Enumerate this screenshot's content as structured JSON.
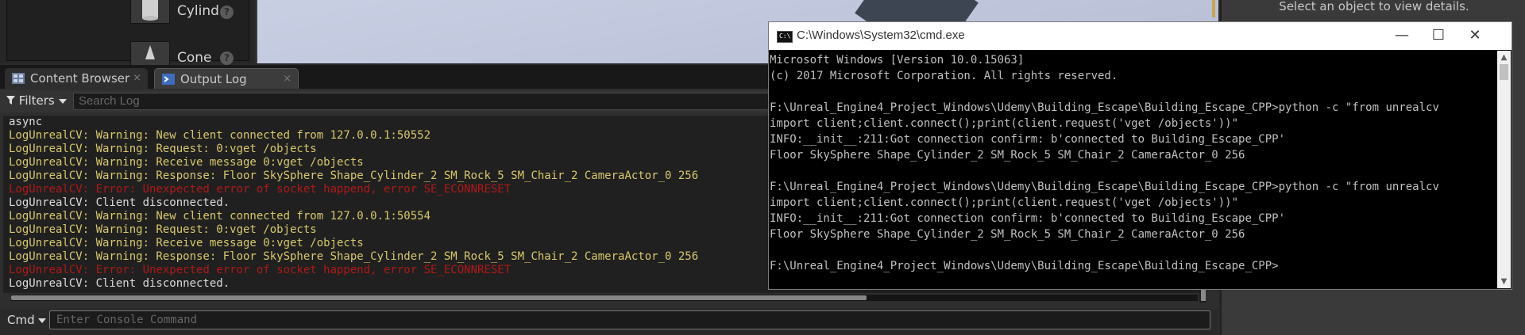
{
  "placement": {
    "items": [
      {
        "label": "Cylind"
      },
      {
        "label": "Cone"
      }
    ],
    "info_glyph": "?"
  },
  "details": {
    "hint": "Select an object to view details."
  },
  "tabs": [
    {
      "label": "Content Browser",
      "icon": "content-browser-icon",
      "close": "×",
      "active": false
    },
    {
      "label": "Output Log",
      "icon": "output-log-icon",
      "close": "×",
      "active": true
    }
  ],
  "output_log": {
    "filters_label": "Filters",
    "search_placeholder": "Search Log",
    "lines": [
      {
        "text": "async",
        "level": "info"
      },
      {
        "text": "LogUnrealCV: Warning: New client connected from 127.0.0.1:50552",
        "level": "warning"
      },
      {
        "text": "LogUnrealCV: Warning: Request: 0:vget /objects",
        "level": "warning"
      },
      {
        "text": "LogUnrealCV: Warning: Receive message 0:vget /objects",
        "level": "warning"
      },
      {
        "text": "LogUnrealCV: Warning: Response: Floor SkySphere Shape_Cylinder_2 SM_Rock_5 SM_Chair_2 CameraActor_0 256",
        "level": "warning"
      },
      {
        "text": "LogUnrealCV: Error: Unexpected error of socket happend, error SE_ECONNRESET",
        "level": "error"
      },
      {
        "text": "LogUnrealCV: Client disconnected.",
        "level": "info"
      },
      {
        "text": "LogUnrealCV: Warning: New client connected from 127.0.0.1:50554",
        "level": "warning"
      },
      {
        "text": "LogUnrealCV: Warning: Request: 0:vget /objects",
        "level": "warning"
      },
      {
        "text": "LogUnrealCV: Warning: Receive message 0:vget /objects",
        "level": "warning"
      },
      {
        "text": "LogUnrealCV: Warning: Response: Floor SkySphere Shape_Cylinder_2 SM_Rock_5 SM_Chair_2 CameraActor_0 256",
        "level": "warning"
      },
      {
        "text": "LogUnrealCV: Error: Unexpected error of socket happend, error SE_ECONNRESET",
        "level": "error"
      },
      {
        "text": "LogUnrealCV: Client disconnected.",
        "level": "info"
      }
    ],
    "cmd_label": "Cmd",
    "console_placeholder": "Enter Console Command"
  },
  "cmd_window": {
    "title": "C:\\Windows\\System32\\cmd.exe",
    "icon_text": "C:\\",
    "controls": {
      "minimize": "—",
      "maximize": "☐",
      "close": "✕"
    },
    "lines": [
      "Microsoft Windows [Version 10.0.15063]",
      "(c) 2017 Microsoft Corporation. All rights reserved.",
      "",
      "F:\\Unreal_Engine4_Project_Windows\\Udemy\\Building_Escape\\Building_Escape_CPP>python -c \"from unrealcv",
      "import client;client.connect();print(client.request('vget /objects'))\"",
      "INFO:__init__:211:Got connection confirm: b'connected to Building_Escape_CPP'",
      "Floor SkySphere Shape_Cylinder_2 SM_Rock_5 SM_Chair_2 CameraActor_0 256",
      "",
      "F:\\Unreal_Engine4_Project_Windows\\Udemy\\Building_Escape\\Building_Escape_CPP>python -c \"from unrealcv",
      "import client;client.connect();print(client.request('vget /objects'))\"",
      "INFO:__init__:211:Got connection confirm: b'connected to Building_Escape_CPP'",
      "Floor SkySphere Shape_Cylinder_2 SM_Rock_5 SM_Chair_2 CameraActor_0 256",
      "",
      "F:\\Unreal_Engine4_Project_Windows\\Udemy\\Building_Escape\\Building_Escape_CPP>"
    ]
  },
  "colors": {
    "log_warning": "#d8c86a",
    "log_error": "#b01818",
    "log_info": "#dcdcdc",
    "cmd_text": "#c0c0c0"
  }
}
